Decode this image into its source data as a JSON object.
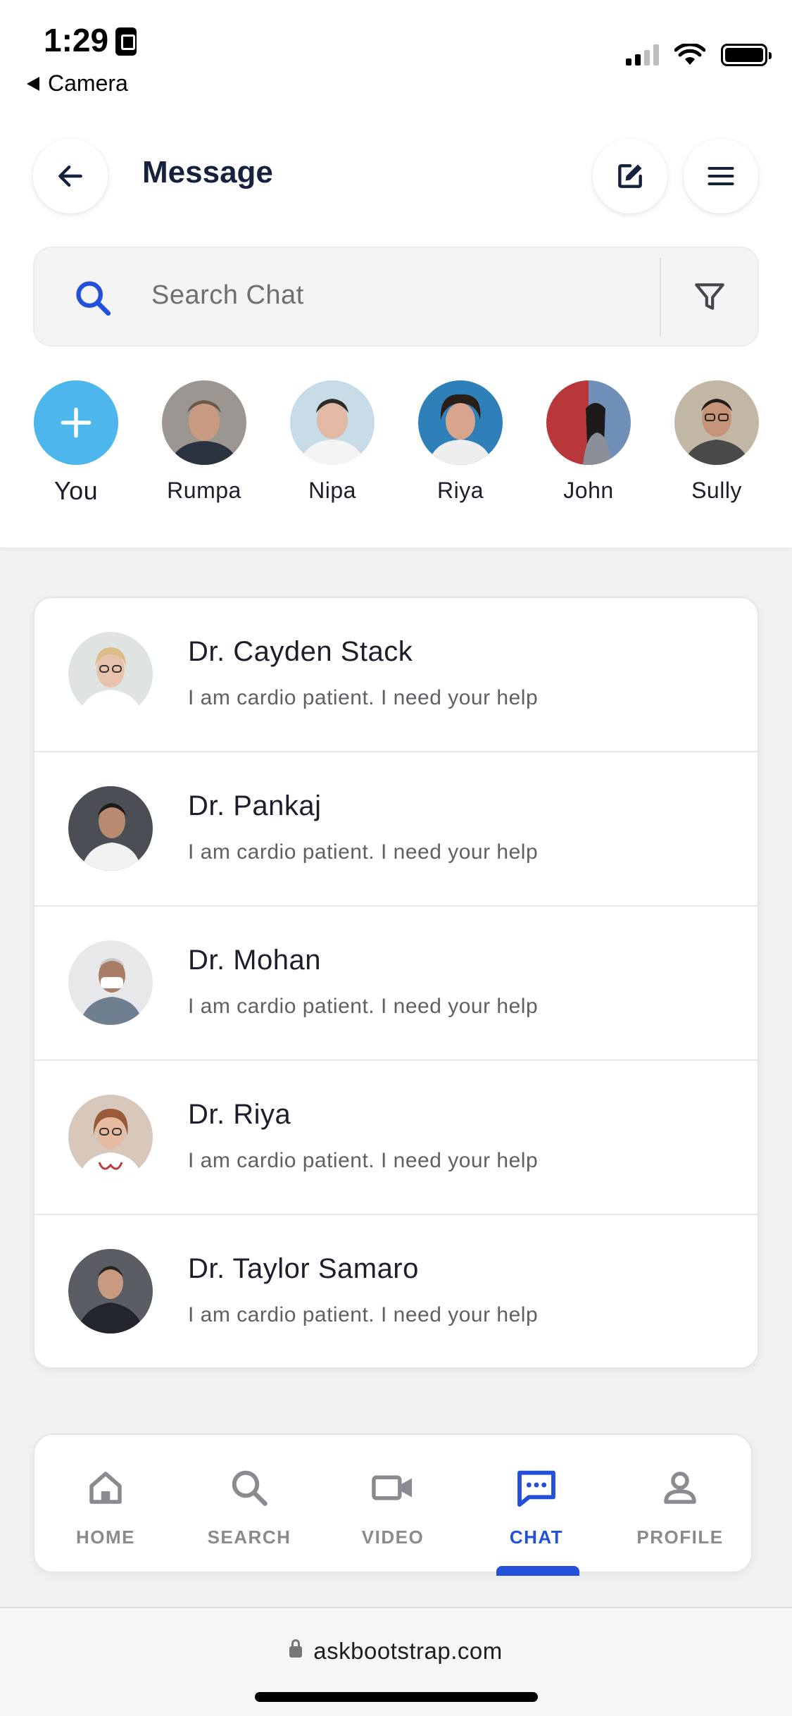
{
  "status_bar": {
    "time": "1:29",
    "back_app": "Camera"
  },
  "header": {
    "title": "Message",
    "back_icon": "arrow-left-icon",
    "compose_icon": "compose-icon",
    "menu_icon": "hamburger-menu-icon"
  },
  "search": {
    "placeholder": "Search Chat",
    "icon": "search-icon",
    "filter_icon": "filter-icon"
  },
  "stories": [
    {
      "name": "You"
    },
    {
      "name": "Rumpa"
    },
    {
      "name": "Nipa"
    },
    {
      "name": "Riya"
    },
    {
      "name": "John"
    },
    {
      "name": "Sully"
    }
  ],
  "chats": [
    {
      "name": "Dr. Cayden Stack",
      "message": "I am cardio patient. I need your help"
    },
    {
      "name": "Dr. Pankaj",
      "message": "I am cardio patient. I need your help"
    },
    {
      "name": "Dr. Mohan",
      "message": "I am cardio patient. I need your help"
    },
    {
      "name": "Dr. Riya",
      "message": "I am cardio patient. I need your help"
    },
    {
      "name": "Dr. Taylor Samaro",
      "message": "I am cardio patient. I need your help"
    }
  ],
  "bottom_nav": [
    {
      "label": "HOME",
      "icon": "home-icon"
    },
    {
      "label": "SEARCH",
      "icon": "search-icon"
    },
    {
      "label": "VIDEO",
      "icon": "video-camera-icon"
    },
    {
      "label": "CHAT",
      "icon": "chat-bubble-icon",
      "active": true
    },
    {
      "label": "PROFILE",
      "icon": "profile-icon"
    }
  ],
  "browser": {
    "url": "askbootstrap.com"
  },
  "colors": {
    "accent": "#2350d8",
    "story_add": "#4db6ec",
    "title": "#16213e"
  }
}
